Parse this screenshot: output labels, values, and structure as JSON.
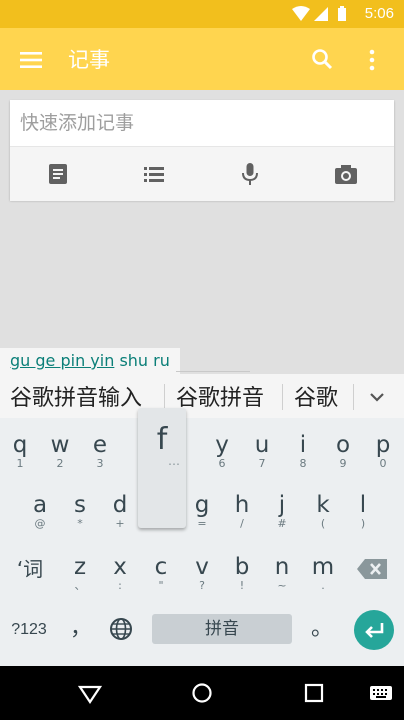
{
  "status_bar": {
    "time": "5:06"
  },
  "app_bar": {
    "title": "记事"
  },
  "note_card": {
    "placeholder": "快速添加记事"
  },
  "ime": {
    "composing": {
      "converted": "gu ge pin yin",
      "current": "shu ru"
    },
    "candidates": [
      "谷歌拼音输入",
      "谷歌拼音",
      "谷歌"
    ]
  },
  "keyboard": {
    "row1": [
      {
        "label": "q",
        "hint": "1"
      },
      {
        "label": "w",
        "hint": "2"
      },
      {
        "label": "e",
        "hint": "3"
      },
      {
        "label": "t",
        "hint": "5"
      },
      {
        "label": "y",
        "hint": "6"
      },
      {
        "label": "u",
        "hint": "7"
      },
      {
        "label": "i",
        "hint": "8"
      },
      {
        "label": "o",
        "hint": "9"
      },
      {
        "label": "p",
        "hint": "0"
      }
    ],
    "popup": {
      "label": "f",
      "hint": "…"
    },
    "row2": [
      {
        "label": "a",
        "hint": "@"
      },
      {
        "label": "s",
        "hint": "*"
      },
      {
        "label": "d",
        "hint": "+"
      },
      {
        "label": "g",
        "hint": "="
      },
      {
        "label": "h",
        "hint": "/"
      },
      {
        "label": "j",
        "hint": "#"
      },
      {
        "label": "k",
        "hint": "("
      },
      {
        "label": "l",
        "hint": ")"
      }
    ],
    "row3_shift": "‘词",
    "row3": [
      {
        "label": "z",
        "hint": "、"
      },
      {
        "label": "x",
        "hint": ":"
      },
      {
        "label": "c",
        "hint": "\""
      },
      {
        "label": "v",
        "hint": "?"
      },
      {
        "label": "b",
        "hint": "!"
      },
      {
        "label": "n",
        "hint": "~"
      },
      {
        "label": "m",
        "hint": "."
      }
    ],
    "symbols_key": "?123",
    "comma": "，",
    "space": "拼音",
    "period": "。"
  }
}
